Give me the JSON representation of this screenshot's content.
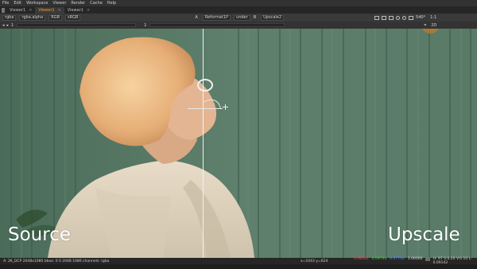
{
  "menu": [
    "File",
    "Edit",
    "Workspace",
    "Viewer",
    "Render",
    "Cache",
    "Help"
  ],
  "tabs": [
    {
      "label": "Viewer1",
      "active": false
    },
    {
      "label": "Viewer1",
      "active": true
    },
    {
      "label": "Viewer1",
      "active": false
    }
  ],
  "toolbar": {
    "channels": "rgba",
    "channel_layer": "rgba.alpha",
    "display": "RGB",
    "colorspace": "sRGB",
    "input_a_letter": "A",
    "input_a_node": "Reformat1P",
    "blend_mode": "under",
    "input_b_letter": "B",
    "input_b_node": "Upscale2",
    "resolution": "540*",
    "zoom": "1:1"
  },
  "toolbar2": {
    "frame_value": "1",
    "frame_value_right": "1",
    "mode_2d": "2D"
  },
  "viewer": {
    "left_label": "Source",
    "right_label": "Upscale"
  },
  "status": {
    "info": "A: 2K_DCP 2048x1080  bbox: 0 0 2048 1080 channels: rgba",
    "coords": "x=1043 y=624",
    "r": "0.08522",
    "g": "0.09744",
    "b": "0.07700",
    "a": "1.00000",
    "hsv": "H: 97 S:0.20 V:0.10  L: 0.09142"
  },
  "colors": {
    "active_tab": "#ff9a1f",
    "r_value": "#ff4d4d",
    "g_value": "#4dd24d",
    "b_value": "#5a8cff"
  }
}
